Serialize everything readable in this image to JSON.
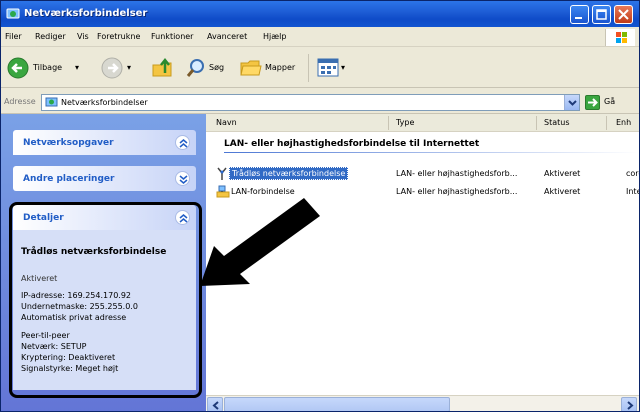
{
  "window": {
    "title": "Netværksforbindelser"
  },
  "menubar": {
    "items": [
      "Filer",
      "Rediger",
      "Vis",
      "Foretrukne",
      "Funktioner",
      "Avanceret",
      "Hjælp"
    ]
  },
  "toolbar": {
    "back_label": "Tilbage",
    "search_label": "Søg",
    "folders_label": "Mapper"
  },
  "address": {
    "label": "Adresse",
    "value": "Netværksforbindelser",
    "go_label": "Gå"
  },
  "sidebar": {
    "panels": [
      {
        "title": "Netværksopgaver",
        "state": "expanded"
      },
      {
        "title": "Andre placeringer",
        "state": "collapsed"
      },
      {
        "title": "Detaljer",
        "state": "expanded"
      }
    ],
    "details": {
      "name": "Trådløs netværksforbindelse",
      "status": "Aktiveret",
      "ip": "IP-adresse: 169.254.170.92",
      "subnet": "Undernetmaske: 255.255.0.0",
      "auto": "Automatisk privat adresse",
      "peer": "Peer-til-peer",
      "network": "Netværk: SETUP",
      "encryption": "Kryptering: Deaktiveret",
      "signal": "Signalstyrke: Meget højt"
    }
  },
  "list": {
    "columns": [
      "Navn",
      "Type",
      "Status",
      "Enh"
    ],
    "group_title": "LAN- eller højhastighedsforbindelse til Internettet",
    "rows": [
      {
        "name": "Trådløs netværksforbindelse",
        "type": "LAN- eller højhastighedsforb...",
        "status": "Aktiveret",
        "device": "core",
        "icon": "wireless-icon",
        "selected": true
      },
      {
        "name": "LAN-forbindelse",
        "type": "LAN- eller højhastighedsforb...",
        "status": "Aktiveret",
        "device": "Intel",
        "icon": "lan-icon",
        "selected": false
      }
    ]
  },
  "colors": {
    "titlebar": "#0f4bc8",
    "sidebar": "#6375d6",
    "selection": "#316ac5",
    "panel_title": "#215dc6"
  }
}
